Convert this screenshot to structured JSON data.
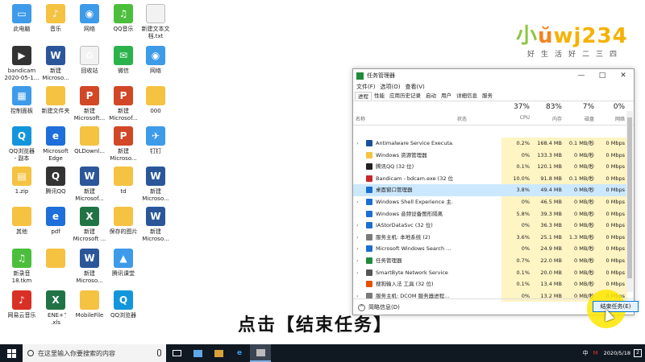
{
  "desktop_icons": [
    {
      "label": "此电脑",
      "color": "c-lblue",
      "glyph": "▭",
      "icon": "computer-icon"
    },
    {
      "label": "音乐",
      "color": "c-folder",
      "glyph": "♪",
      "icon": "music-folder-icon"
    },
    {
      "label": "网络",
      "color": "c-lblue",
      "glyph": "◉",
      "icon": "network-icon"
    },
    {
      "label": "QQ音乐",
      "color": "c-yellowgreen",
      "glyph": "♫",
      "icon": "qq-music-icon"
    },
    {
      "label": "新建文本文\n档.txt",
      "color": "c-file",
      "glyph": "",
      "icon": "text-file-icon"
    },
    {
      "label": "bandicam\n2020-05-1...",
      "color": "c-dark",
      "glyph": "▶",
      "icon": "video-file-icon"
    },
    {
      "label": "新建\nMicroso...",
      "color": "c-word",
      "glyph": "W",
      "icon": "word-doc-icon"
    },
    {
      "label": "回收站",
      "color": "c-file",
      "glyph": "♻",
      "icon": "recycle-bin-icon"
    },
    {
      "label": "微信",
      "color": "c-green",
      "glyph": "✉",
      "icon": "wechat-icon"
    },
    {
      "label": "网络",
      "color": "c-lblue",
      "glyph": "◉",
      "icon": "network-icon"
    },
    {
      "label": "控制面板",
      "color": "c-lblue",
      "glyph": "▦",
      "icon": "control-panel-icon"
    },
    {
      "label": "新建文件夹",
      "color": "c-folder",
      "glyph": "",
      "icon": "folder-icon"
    },
    {
      "label": "新建\nMicrosoft...",
      "color": "c-ppt",
      "glyph": "P",
      "icon": "ppt-doc-icon"
    },
    {
      "label": "新建\nMicrosof...",
      "color": "c-ppt",
      "glyph": "P",
      "icon": "ppt-doc-icon"
    },
    {
      "label": "000",
      "color": "c-folder",
      "glyph": "",
      "icon": "folder-icon"
    },
    {
      "label": "QQ浏览器\n- 副本",
      "color": "c-qq",
      "glyph": "Q",
      "icon": "qq-browser-icon"
    },
    {
      "label": "Microsoft\nEdge",
      "color": "c-blue",
      "glyph": "e",
      "icon": "edge-icon"
    },
    {
      "label": "QLDownl...",
      "color": "c-folder",
      "glyph": "",
      "icon": "folder-icon"
    },
    {
      "label": "新建\nMicroso...",
      "color": "c-ppt",
      "glyph": "P",
      "icon": "ppt-doc-icon"
    },
    {
      "label": "钉钉",
      "color": "c-lblue",
      "glyph": "✈",
      "icon": "dingtalk-icon"
    },
    {
      "label": "1.zip",
      "color": "c-folder",
      "glyph": "▤",
      "icon": "zip-file-icon"
    },
    {
      "label": "腾讯QQ",
      "color": "c-dark",
      "glyph": "Q",
      "icon": "qq-icon"
    },
    {
      "label": "新建\nMicrosof...",
      "color": "c-word",
      "glyph": "W",
      "icon": "word-doc-icon"
    },
    {
      "label": "td",
      "color": "c-folder",
      "glyph": "",
      "icon": "folder-icon"
    },
    {
      "label": "新建\nMicroso...",
      "color": "c-word",
      "glyph": "W",
      "icon": "word-doc-icon"
    },
    {
      "label": "其他",
      "color": "c-folder",
      "glyph": "",
      "icon": "folder-icon"
    },
    {
      "label": "pdf",
      "color": "c-blue",
      "glyph": "e",
      "icon": "pdf-file-icon"
    },
    {
      "label": "新建\nMicrosoft ...",
      "color": "c-excel",
      "glyph": "X",
      "icon": "excel-doc-icon"
    },
    {
      "label": "保存的图片",
      "color": "c-folder",
      "glyph": "",
      "icon": "folder-icon"
    },
    {
      "label": "新建\nMicroso...",
      "color": "c-word",
      "glyph": "W",
      "icon": "word-doc-icon"
    },
    {
      "label": "新录音\n18.tkm",
      "color": "c-yellowgreen",
      "glyph": "♫",
      "icon": "audio-file-icon"
    },
    {
      "label": "",
      "color": "c-folder",
      "glyph": "",
      "icon": "folder-icon"
    },
    {
      "label": "新建\nMicroso...",
      "color": "c-word",
      "glyph": "W",
      "icon": "word-doc-icon"
    },
    {
      "label": "腾讯课堂",
      "color": "c-lblue",
      "glyph": "▲",
      "icon": "tencent-classroom-icon"
    },
    {
      "label": "",
      "color": "",
      "glyph": "",
      "icon": "empty-slot"
    },
    {
      "label": "网易云音乐",
      "color": "c-red",
      "glyph": "♪",
      "icon": "netease-music-icon"
    },
    {
      "label": "ENE+ֵܽ\n.xls",
      "color": "c-excel",
      "glyph": "X",
      "icon": "excel-doc-icon"
    },
    {
      "label": "MobileFile",
      "color": "c-folder",
      "glyph": "",
      "icon": "folder-icon"
    },
    {
      "label": "QQ浏览器",
      "color": "c-qq",
      "glyph": "Q",
      "icon": "qq-browser-icon"
    }
  ],
  "logo": {
    "text_a": "小",
    "text_b": "ŭ",
    "text_c": "wj234",
    "sub": "好生活好二三四"
  },
  "task_manager": {
    "title": "任务管理器",
    "win_min": "—",
    "win_max": "□",
    "win_close": "✕",
    "menu": [
      "文件(F)",
      "选项(O)",
      "查看(V)"
    ],
    "tabs": [
      "进程",
      "性能",
      "应用历史记录",
      "启动",
      "用户",
      "详细信息",
      "服务"
    ],
    "headers": {
      "name": "名称",
      "status": "状态",
      "cpu_pct": "37%",
      "cpu": "CPU",
      "mem_pct": "83%",
      "mem": "内存",
      "disk_pct": "7%",
      "disk": "磁盘",
      "net_pct": "0%",
      "net": "网络"
    },
    "rows": [
      {
        "expand": "›",
        "name": "Antimalware Service Executa...",
        "cpu": "0.2%",
        "mem": "168.4 MB",
        "disk": "0.1 MB/秒",
        "net": "0 Mbps",
        "color": "#1a4f9c"
      },
      {
        "expand": "",
        "name": "Windows 资源管理器",
        "cpu": "0%",
        "mem": "133.3 MB",
        "disk": "0 MB/秒",
        "net": "0 Mbps",
        "color": "#f5c242"
      },
      {
        "expand": "",
        "name": "腾讯QQ (32 位)",
        "cpu": "0.1%",
        "mem": "120.1 MB",
        "disk": "0 MB/秒",
        "net": "0 Mbps",
        "color": "#222"
      },
      {
        "expand": "",
        "name": "Bandicam - bdcam.exe (32 位)",
        "cpu": "10.0%",
        "mem": "91.8 MB",
        "disk": "0.1 MB/秒",
        "net": "0 Mbps",
        "color": "#c62828"
      },
      {
        "expand": "",
        "name": "桌面窗口管理器",
        "cpu": "3.8%",
        "mem": "49.4 MB",
        "disk": "0 MB/秒",
        "net": "0 Mbps",
        "color": "#1a6fd0"
      },
      {
        "expand": "›",
        "name": "Windows Shell Experience 主...",
        "cpu": "0%",
        "mem": "46.5 MB",
        "disk": "0 MB/秒",
        "net": "0 Mbps",
        "color": "#1a6fd0"
      },
      {
        "expand": "",
        "name": "Windows 音频设备图形隔离",
        "cpu": "5.8%",
        "mem": "39.3 MB",
        "disk": "0 MB/秒",
        "net": "0 Mbps",
        "color": "#1a6fd0"
      },
      {
        "expand": "›",
        "name": "IAStorDataSvc (32 位)",
        "cpu": "0%",
        "mem": "36.3 MB",
        "disk": "0 MB/秒",
        "net": "0 Mbps",
        "color": "#1a6fd0"
      },
      {
        "expand": "›",
        "name": "服务主机: 本地系统 (2)",
        "cpu": "3.6%",
        "mem": "25.1 MB",
        "disk": "1.3 MB/秒",
        "net": "0 Mbps",
        "color": "#7a7a7a"
      },
      {
        "expand": "›",
        "name": "Microsoft Windows Search ...",
        "cpu": "0%",
        "mem": "24.9 MB",
        "disk": "0 MB/秒",
        "net": "0 Mbps",
        "color": "#1a6fd0"
      },
      {
        "expand": "›",
        "name": "任务管理器",
        "cpu": "0.7%",
        "mem": "22.0 MB",
        "disk": "0 MB/秒",
        "net": "0 Mbps",
        "color": "#1f8a3a"
      },
      {
        "expand": "›",
        "name": "SmartByte Network Service",
        "cpu": "0.1%",
        "mem": "20.0 MB",
        "disk": "0 MB/秒",
        "net": "0 Mbps",
        "color": "#555"
      },
      {
        "expand": "",
        "name": "搜狗输入法 工具 (32 位)",
        "cpu": "0.1%",
        "mem": "13.4 MB",
        "disk": "0 MB/秒",
        "net": "0 Mbps",
        "color": "#e65100"
      },
      {
        "expand": "›",
        "name": "服务主机: DCOM 服务器进程...",
        "cpu": "0%",
        "mem": "13.2 MB",
        "disk": "0 MB/秒",
        "net": "0 Mbps",
        "color": "#7a7a7a"
      }
    ],
    "selected_row": "桌面窗口管理器",
    "fewer_details": "简略信息(D)",
    "end_task": "结束任务(E)"
  },
  "subtitle": "点击【结束任务】",
  "taskbar": {
    "search_placeholder": "在这里输入你要搜索的内容",
    "apps": [
      "task-view-icon",
      "mail-icon",
      "store-icon",
      "edge-icon",
      "task-manager-icon"
    ],
    "clock_time": "",
    "clock_date": "2020/5/18",
    "tray_text": "中"
  }
}
